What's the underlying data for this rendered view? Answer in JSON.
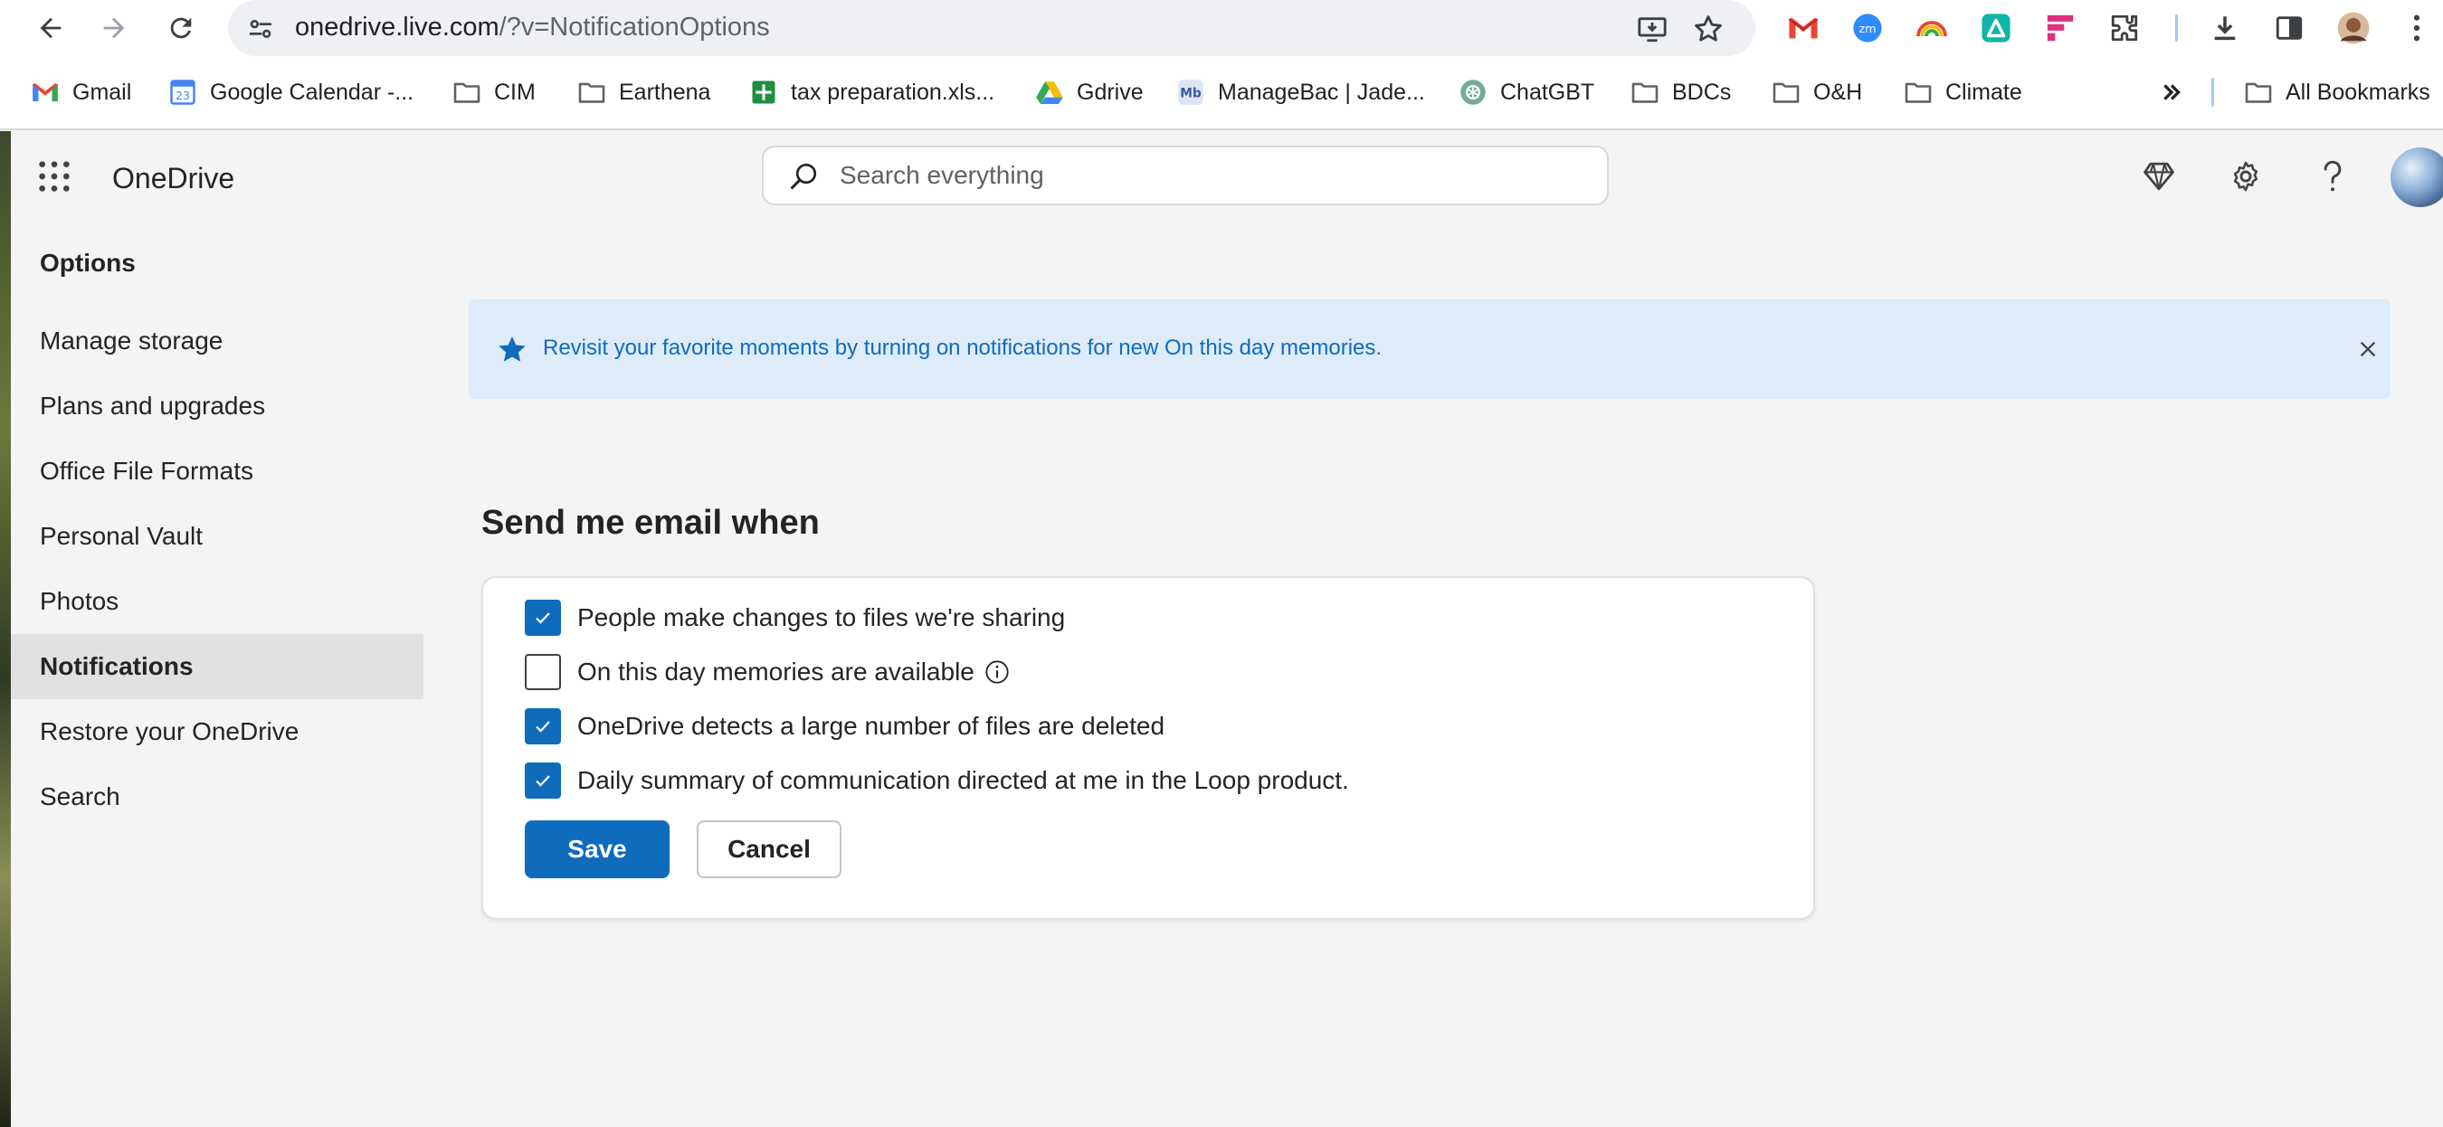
{
  "browser": {
    "url_host": "onedrive.live.com",
    "url_path": "/?v=NotificationOptions",
    "bookmarks": [
      {
        "label": "Gmail",
        "icon": "gmail-icon"
      },
      {
        "label": "Google Calendar -...",
        "icon": "calendar-icon"
      },
      {
        "label": "CIM",
        "icon": "folder-icon"
      },
      {
        "label": "Earthena",
        "icon": "folder-icon"
      },
      {
        "label": "tax preparation.xls...",
        "icon": "sheets-icon"
      },
      {
        "label": "Gdrive",
        "icon": "drive-icon"
      },
      {
        "label": "ManageBac | Jade...",
        "icon": "managebac-icon"
      },
      {
        "label": "ChatGBT",
        "icon": "chatgpt-icon"
      },
      {
        "label": "BDCs",
        "icon": "folder-icon"
      },
      {
        "label": "O&H",
        "icon": "folder-icon"
      },
      {
        "label": "Climate",
        "icon": "folder-icon"
      }
    ],
    "all_bookmarks_label": "All Bookmarks"
  },
  "app": {
    "brand": "OneDrive",
    "search_placeholder": "Search everything"
  },
  "sidebar": {
    "title": "Options",
    "items": [
      {
        "label": "Manage storage",
        "active": false
      },
      {
        "label": "Plans and upgrades",
        "active": false
      },
      {
        "label": "Office File Formats",
        "active": false
      },
      {
        "label": "Personal Vault",
        "active": false
      },
      {
        "label": "Photos",
        "active": false
      },
      {
        "label": "Notifications",
        "active": true
      },
      {
        "label": "Restore your OneDrive",
        "active": false
      },
      {
        "label": "Search",
        "active": false
      }
    ]
  },
  "banner": {
    "text": "Revisit your favorite moments by turning on notifications for new On this day memories."
  },
  "main": {
    "heading": "Send me email when",
    "options": [
      {
        "label": "People make changes to files we're sharing",
        "checked": true
      },
      {
        "label": "On this day memories are available",
        "checked": false
      },
      {
        "label": "OneDrive detects a large number of files are deleted",
        "checked": true
      },
      {
        "label": "Daily summary of communication directed at me in the Loop product.",
        "checked": true
      }
    ],
    "save_label": "Save",
    "cancel_label": "Cancel"
  },
  "colors": {
    "accent": "#0f6cbd",
    "banner_bg": "#deebf8"
  }
}
